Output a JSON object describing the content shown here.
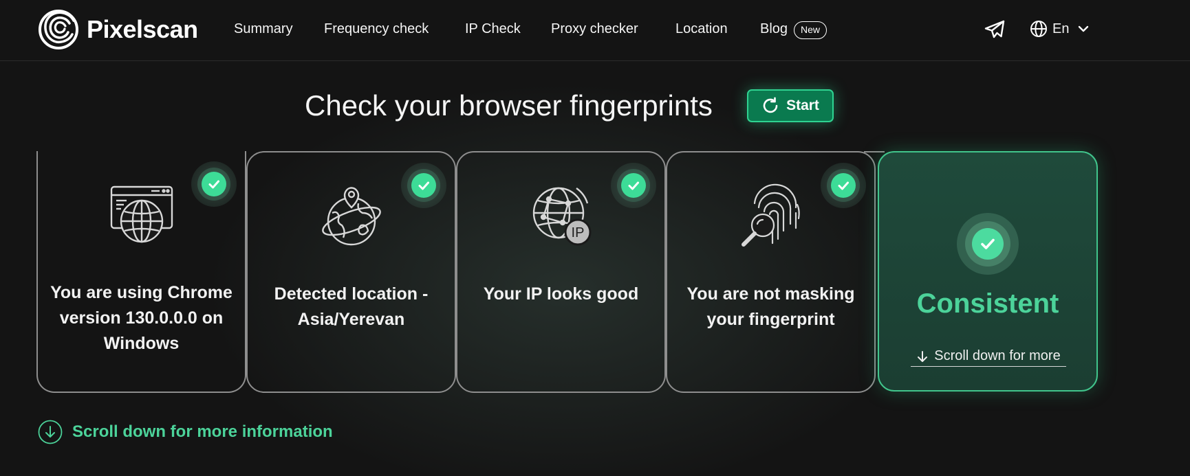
{
  "brand": {
    "name": "Pixelscan",
    "accent": "#3ddc97"
  },
  "nav": {
    "items": [
      {
        "label": "Summary"
      },
      {
        "label": "Frequency check"
      },
      {
        "label": "IP Check"
      },
      {
        "label": "Proxy checker"
      },
      {
        "label": "Location"
      },
      {
        "label": "Blog"
      }
    ],
    "blog_badge": "New",
    "telegram_icon": "telegram-icon",
    "language": "En"
  },
  "hero": {
    "title": "Check your browser fingerprints",
    "start_label": "Start"
  },
  "cards": [
    {
      "icon": "browser-globe-icon",
      "text": "You are using Chrome version 130.0.0.0 on Windows",
      "status": "ok"
    },
    {
      "icon": "location-globe-icon",
      "text": "Detected location - Asia/Yerevan",
      "status": "ok"
    },
    {
      "icon": "ip-globe-icon",
      "text": "Your IP looks good",
      "status": "ok",
      "icon_label": "IP"
    },
    {
      "icon": "fingerprint-search-icon",
      "text": "You are not masking your fingerprint",
      "status": "ok"
    }
  ],
  "result": {
    "title": "Consistent",
    "link_label": "Scroll down for more"
  },
  "footer_link": "Scroll down for more information"
}
